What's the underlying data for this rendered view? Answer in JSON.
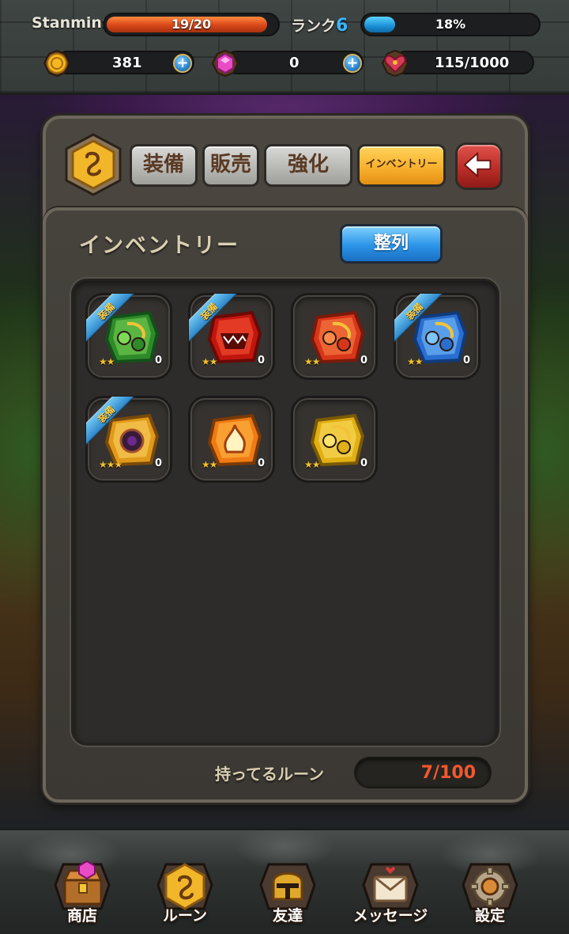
{
  "status": {
    "player_name": "Stanmina",
    "stamina_text": "19/20",
    "stamina_fraction": 0.95,
    "rank_label": "ランク",
    "rank_value": "6",
    "exp_text": "18%",
    "exp_fraction": 0.18,
    "gold": "381",
    "gems": "0",
    "hearts": "115/1000"
  },
  "tabs": [
    {
      "label": "装備",
      "active": false
    },
    {
      "label": "販売",
      "active": false
    },
    {
      "label": "強化",
      "active": false
    },
    {
      "label": "インベントリー",
      "active": true
    }
  ],
  "inventory": {
    "title": "インベントリー",
    "sort_label": "整列",
    "equipped_label": "装備",
    "count_label": "持ってるルーン",
    "count_value": "7/100"
  },
  "runes": [
    {
      "color": "green",
      "stars": 2,
      "level": "0",
      "equipped": true
    },
    {
      "color": "red",
      "stars": 2,
      "level": "0",
      "equipped": true
    },
    {
      "color": "orange",
      "stars": 2,
      "level": "0",
      "equipped": false
    },
    {
      "color": "blue",
      "stars": 2,
      "level": "0",
      "equipped": true
    },
    {
      "color": "gold-eye",
      "stars": 3,
      "level": "0",
      "equipped": true
    },
    {
      "color": "orange-fire",
      "stars": 2,
      "level": "0",
      "equipped": false
    },
    {
      "color": "yellow",
      "stars": 2,
      "level": "0",
      "equipped": false
    }
  ],
  "nav": [
    {
      "label": "商店",
      "icon": "treasure-chest-icon"
    },
    {
      "label": "ルーン",
      "icon": "rune-emblem-icon"
    },
    {
      "label": "友達",
      "icon": "helmet-icon"
    },
    {
      "label": "メッセージ",
      "icon": "mailbox-icon"
    },
    {
      "label": "設定",
      "icon": "gear-icon"
    }
  ],
  "colors": {
    "stamina": "#d8471a",
    "exp": "#1b8fd6",
    "active_tab": "#f7ae2b",
    "rune_count": "#f2582e"
  }
}
